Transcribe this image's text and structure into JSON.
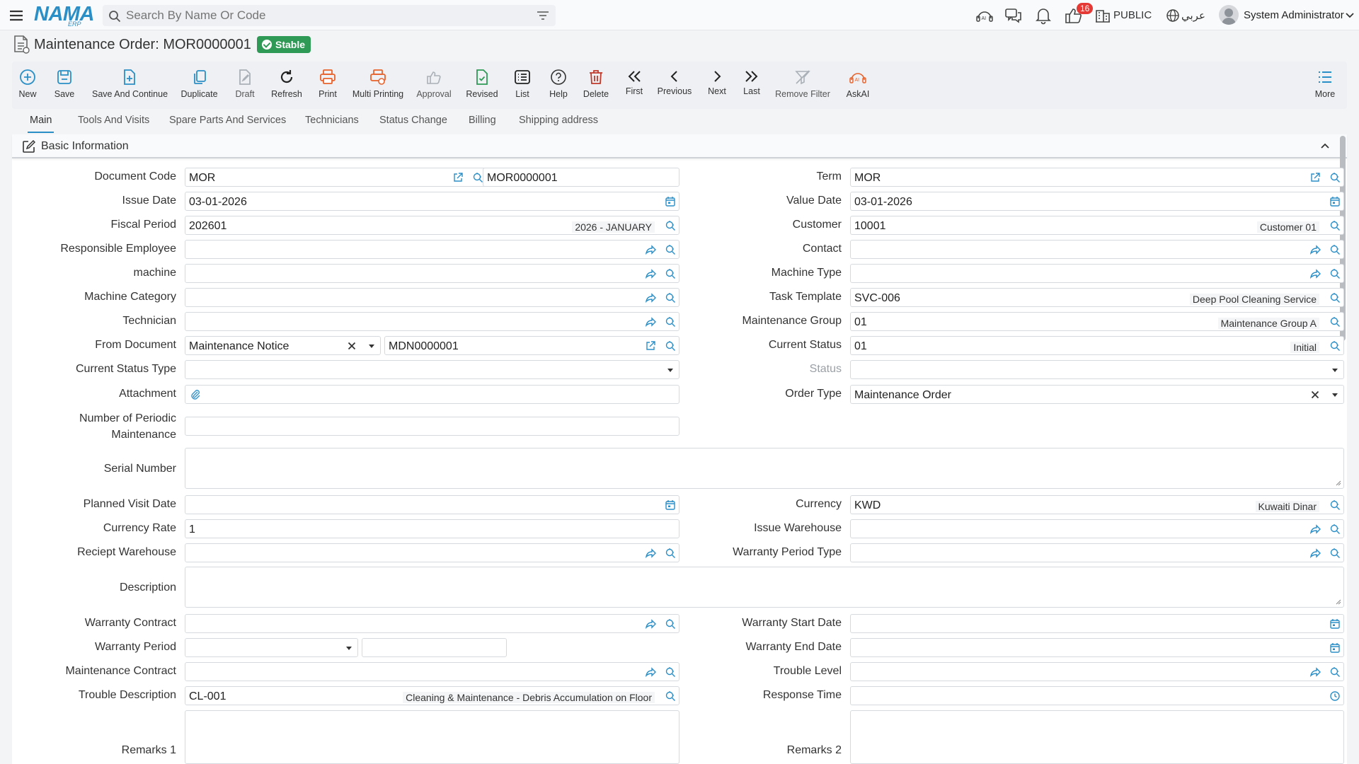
{
  "app": {
    "logo_text": "NAMA",
    "logo_sub": "ERP",
    "search_placeholder": "Search By Name Or Code",
    "notification_count": "16",
    "org_label": "PUBLIC",
    "language_label": "عربي",
    "user_name": "System Administrator"
  },
  "page": {
    "title": "Maintenance Order: MOR0000001",
    "status_badge": "Stable"
  },
  "toolbar": {
    "new": "New",
    "save": "Save",
    "save_continue": "Save And Continue",
    "duplicate": "Duplicate",
    "draft": "Draft",
    "refresh": "Refresh",
    "print": "Print",
    "multi_printing": "Multi Printing",
    "approval": "Approval",
    "revised": "Revised",
    "list": "List",
    "help": "Help",
    "delete": "Delete",
    "first": "First",
    "previous": "Previous",
    "next": "Next",
    "last": "Last",
    "remove_filter": "Remove Filter",
    "askai": "AskAI",
    "more": "More"
  },
  "tabs": {
    "main": "Main",
    "tools_visits": "Tools And Visits",
    "spare_parts": "Spare Parts And Services",
    "technicians": "Technicians",
    "status_change": "Status Change",
    "billing": "Billing",
    "shipping": "Shipping address"
  },
  "section": {
    "title": "Basic Information"
  },
  "colors": {
    "accent": "#2b8fc7",
    "stable": "#2e9a55",
    "print": "#e8622c",
    "delete": "#c0392b",
    "revised": "#2e9a55"
  },
  "labels": {
    "document_code": "Document Code",
    "term": "Term",
    "issue_date": "Issue Date",
    "value_date": "Value Date",
    "fiscal_period": "Fiscal Period",
    "customer": "Customer",
    "responsible_employee": "Responsible Employee",
    "contact": "Contact",
    "machine": "machine",
    "machine_type": "Machine Type",
    "machine_category": "Machine Category",
    "task_template": "Task Template",
    "technician": "Technician",
    "maintenance_group": "Maintenance Group",
    "from_document": "From Document",
    "current_status": "Current Status",
    "current_status_type": "Current Status Type",
    "status": "Status",
    "attachment": "Attachment",
    "order_type": "Order Type",
    "number_periodic": "Number of Periodic Maintenance",
    "serial_number": "Serial Number",
    "planned_visit_date": "Planned Visit Date",
    "currency": "Currency",
    "currency_rate": "Currency Rate",
    "issue_warehouse": "Issue Warehouse",
    "receipt_warehouse": "Reciept Warehouse",
    "warranty_period_type": "Warranty Period Type",
    "description": "Description",
    "warranty_contract": "Warranty Contract",
    "warranty_start_date": "Warranty Start Date",
    "warranty_period": "Warranty Period",
    "warranty_end_date": "Warranty End Date",
    "maintenance_contract": "Maintenance Contract",
    "trouble_level": "Trouble Level",
    "trouble_description": "Trouble Description",
    "response_time": "Response Time",
    "remarks1": "Remarks 1",
    "remarks2": "Remarks 2"
  },
  "values": {
    "document_code": "MOR",
    "document_number": "MOR0000001",
    "term": "MOR",
    "issue_date": "03-01-2026",
    "value_date": "03-01-2026",
    "fiscal_period": "202601",
    "fiscal_period_desc": "2026 - JANUARY",
    "customer": "10001",
    "customer_desc": "Customer 01",
    "task_template": "SVC-006",
    "task_template_desc": "Deep Pool Cleaning Service",
    "maintenance_group": "01",
    "maintenance_group_desc": "Maintenance Group A",
    "from_document_type": "Maintenance Notice",
    "from_document_number": "MDN0000001",
    "current_status": "01",
    "current_status_desc": "Initial",
    "order_type": "Maintenance Order",
    "currency": "KWD",
    "currency_desc": "Kuwaiti Dinar",
    "currency_rate": "1",
    "trouble_description": "CL-001",
    "trouble_description_desc": "Cleaning & Maintenance - Debris Accumulation on Floor"
  }
}
